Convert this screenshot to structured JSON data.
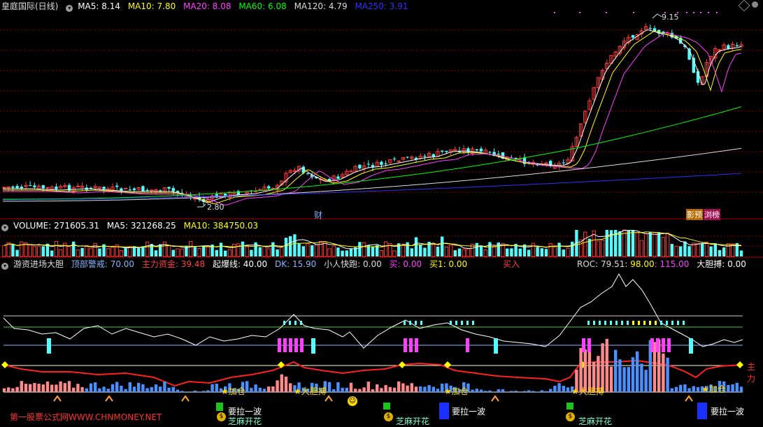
{
  "colors": {
    "up": "#ff3b3b",
    "down": "#54ffff",
    "ma5": "#ffffff",
    "ma10": "#ffff00",
    "ma20": "#ff40ff",
    "ma60": "#00ff00",
    "ma120": "#dddddd",
    "ma250": "#3030ff",
    "yellow": "#ffff00",
    "orange": "#ffa040"
  },
  "main": {
    "title": "皇庭国际(日线)",
    "ma5_label": "MA5: 8.14",
    "ma10_label": "MA10: 7.80",
    "ma20_label": "MA20: 8.08",
    "ma60_label": "MA60: 6.08",
    "ma120_label": "MA120: 4.79",
    "ma250_label": "MA250: 3.91",
    "high_label": "9.15",
    "low_label": "2.80",
    "tag_cai": "财",
    "tag_yingyu": "影预",
    "tag_liubang": "浏榜"
  },
  "volume": {
    "label": "VOLUME: 271605.31",
    "ma5_label": "MA5: 321268.25",
    "ma10_label": "MA10: 384750.03"
  },
  "indicator": {
    "name": "游资进场大胆",
    "top_warn": "顶部警戒: 70.00",
    "main_fund": "主力资金: 39.48",
    "explode": "起爆线: 40.00",
    "dk": "DK: 15.90",
    "small_run": "小人快跑: 0.00",
    "buy": "买: 0.00",
    "buy1": "买1: 0.00",
    "buy_in": "买入",
    "roc": "ROC: 79.51",
    "v98": ": 98.00",
    "v115": ": 115.00",
    "bold_catch": "大胆搏: 0.00",
    "right_label": "主力",
    "signal_add": "加仓",
    "signal_bold": "大胆搏",
    "signal_pull": "要拉一波",
    "signal_bloom": "芝麻开花",
    "watermark": "第一股票公式网WWW.CHNMONEY.NET"
  },
  "chart_data": [
    {
      "type": "candlestick",
      "title": "皇庭国际(日线)",
      "series": [
        {
          "name": "MA5",
          "last": 8.14
        },
        {
          "name": "MA10",
          "last": 7.8
        },
        {
          "name": "MA20",
          "last": 8.08
        },
        {
          "name": "MA60",
          "last": 6.08
        },
        {
          "name": "MA120",
          "last": 4.79
        },
        {
          "name": "MA250",
          "last": 3.91
        }
      ],
      "annotations": [
        {
          "label": "9.15",
          "kind": "high"
        },
        {
          "label": "2.80",
          "kind": "low"
        }
      ]
    },
    {
      "type": "bar",
      "title": "VOLUME",
      "series": [
        {
          "name": "VOLUME",
          "last": 271605.31
        },
        {
          "name": "MA5",
          "last": 321268.25
        },
        {
          "name": "MA10",
          "last": 384750.03
        }
      ]
    },
    {
      "type": "line",
      "title": "游资进场大胆",
      "series": [
        {
          "name": "顶部警戒",
          "last": 70.0
        },
        {
          "name": "主力资金",
          "last": 39.48
        },
        {
          "name": "起爆线",
          "last": 40.0
        },
        {
          "name": "DK",
          "last": 15.9
        },
        {
          "name": "ROC",
          "last": 79.51
        }
      ]
    }
  ]
}
